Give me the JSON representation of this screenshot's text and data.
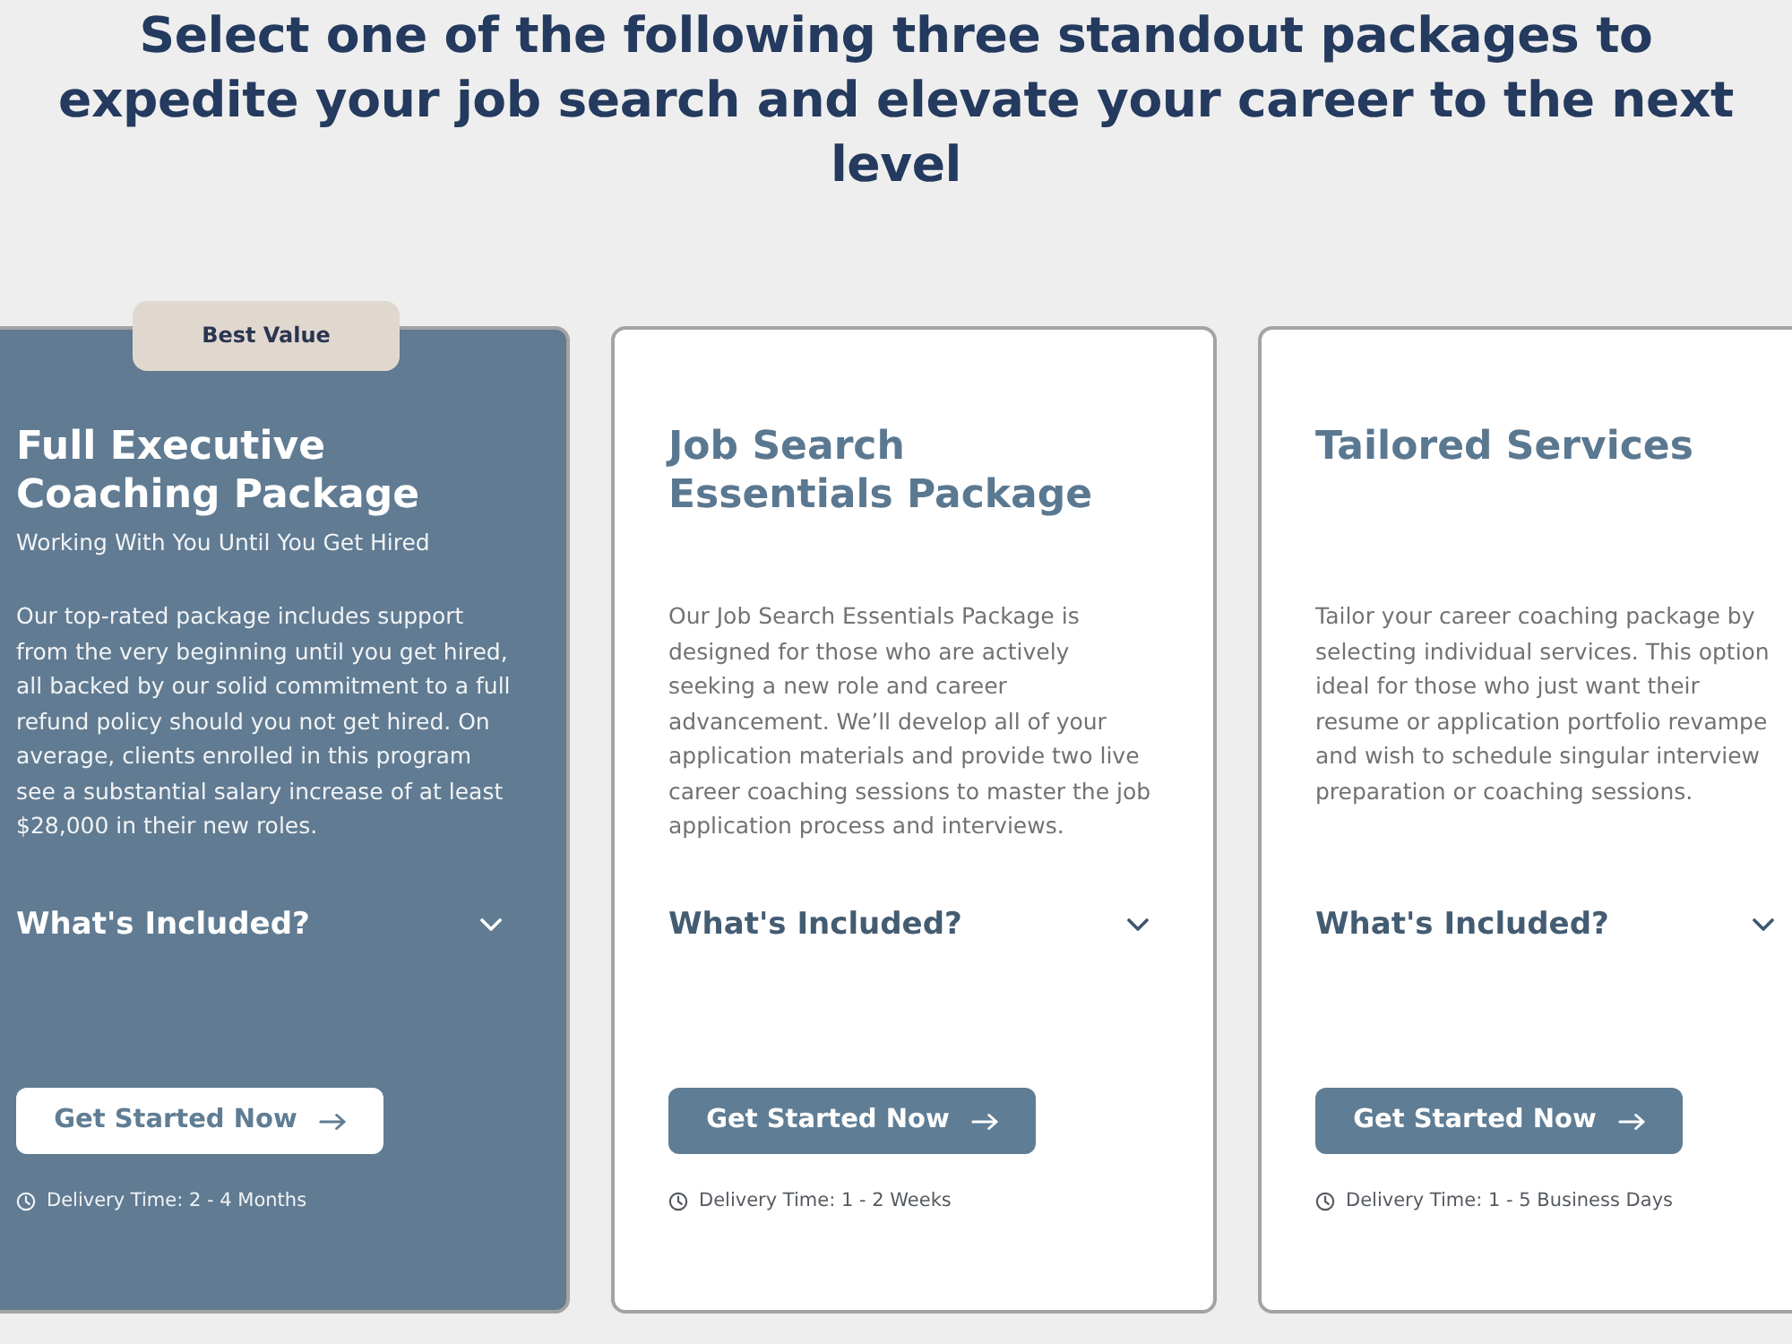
{
  "heading": "Select one of the following three standout packages to expedite your job search and elevate your career to the next level",
  "packages": [
    {
      "highlighted": true,
      "badge": "Best Value",
      "title": "Full Executive Coaching Package",
      "subtitle": "Working With You Until You Get Hired",
      "description": "Our top-rated package includes support from the very beginning until you get hired, all backed by our solid commitment to a full refund policy should you not get hired. On average, clients enrolled in this program see a substantial salary increase of at least $28,000 in their new roles.",
      "included": {
        "label": "What's Included?",
        "expanded": false
      },
      "button": "Get Started Now",
      "delivery": "Delivery Time: 2 - 4 Months"
    },
    {
      "highlighted": false,
      "title": "Job Search Essentials Package",
      "description": "Our Job Search Essentials Package is designed for those who are actively seeking a new role and career advancement. We’ll develop all of your application materials and provide two live career coaching sessions to master the job application process and interviews.",
      "included": {
        "label": "What's Included?",
        "expanded": false
      },
      "button": "Get Started Now",
      "delivery": "Delivery Time: 1 - 2 Weeks"
    },
    {
      "highlighted": false,
      "title": "Tailored Services",
      "description": "Tailor your career coaching package by selecting individual services. This option ideal for those who just want their resume or application portfolio revampe and wish to schedule singular interview preparation or coaching sessions.",
      "included": {
        "label": "What's Included?",
        "expanded": false
      },
      "button": "Get Started Now",
      "delivery": "Delivery Time: 1 - 5 Business Days"
    }
  ]
}
